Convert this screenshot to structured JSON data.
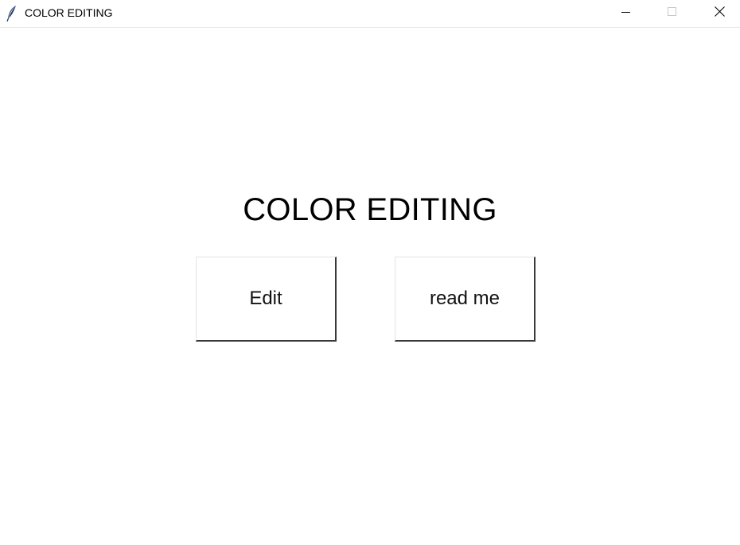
{
  "window": {
    "title": "COLOR EDITING",
    "icon": "feather-icon",
    "controls": [
      "minimize-icon",
      "maximize-icon",
      "close-icon"
    ]
  },
  "main": {
    "heading": "COLOR EDITING",
    "buttons": {
      "edit_label": "Edit",
      "readme_label": "read me"
    }
  },
  "colors": {
    "background": "#ffffff",
    "text": "#000000",
    "button_shadow": "#3a3a3a"
  }
}
